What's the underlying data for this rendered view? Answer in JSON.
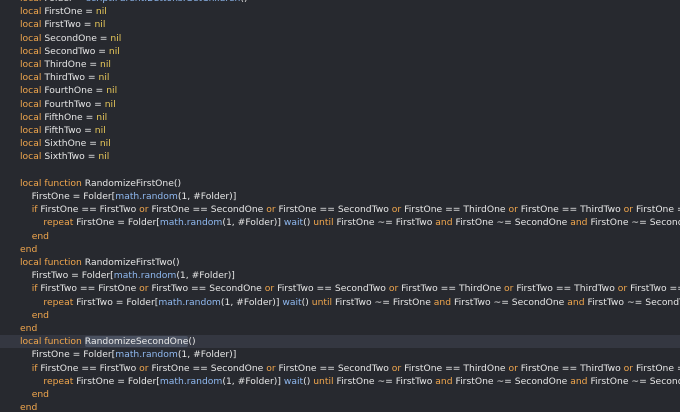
{
  "colors": {
    "background": "#27292f",
    "current_line": "#343741",
    "keyword": "#f0a64d",
    "nil": "#e8c85a",
    "identifier": "#e6e6e6",
    "builtin_call": "#8fb8ef"
  },
  "code_lines": [
    [
      [
        "kw",
        "local "
      ],
      [
        "txt",
        "Folder = "
      ],
      [
        "call",
        "script.Parent.Buttons:GetChildren"
      ],
      [
        "txt",
        "()"
      ]
    ],
    [
      [
        "kw",
        "local "
      ],
      [
        "txt",
        "FirstOne = "
      ],
      [
        "nil",
        "nil"
      ]
    ],
    [
      [
        "kw",
        "local "
      ],
      [
        "txt",
        "FirstTwo = "
      ],
      [
        "nil",
        "nil"
      ]
    ],
    [
      [
        "kw",
        "local "
      ],
      [
        "txt",
        "SecondOne = "
      ],
      [
        "nil",
        "nil"
      ]
    ],
    [
      [
        "kw",
        "local "
      ],
      [
        "txt",
        "SecondTwo = "
      ],
      [
        "nil",
        "nil"
      ]
    ],
    [
      [
        "kw",
        "local "
      ],
      [
        "txt",
        "ThirdOne = "
      ],
      [
        "nil",
        "nil"
      ]
    ],
    [
      [
        "kw",
        "local "
      ],
      [
        "txt",
        "ThirdTwo = "
      ],
      [
        "nil",
        "nil"
      ]
    ],
    [
      [
        "kw",
        "local "
      ],
      [
        "txt",
        "FourthOne = "
      ],
      [
        "nil",
        "nil"
      ]
    ],
    [
      [
        "kw",
        "local "
      ],
      [
        "txt",
        "FourthTwo = "
      ],
      [
        "nil",
        "nil"
      ]
    ],
    [
      [
        "kw",
        "local "
      ],
      [
        "txt",
        "FifthOne = "
      ],
      [
        "nil",
        "nil"
      ]
    ],
    [
      [
        "kw",
        "local "
      ],
      [
        "txt",
        "FifthTwo = "
      ],
      [
        "nil",
        "nil"
      ]
    ],
    [
      [
        "kw",
        "local "
      ],
      [
        "txt",
        "SixthOne = "
      ],
      [
        "nil",
        "nil"
      ]
    ],
    [
      [
        "kw",
        "local "
      ],
      [
        "txt",
        "SixthTwo = "
      ],
      [
        "nil",
        "nil"
      ]
    ],
    [],
    [
      [
        "kw",
        "local function "
      ],
      [
        "fn",
        "RandomizeFirstOne"
      ],
      [
        "txt",
        "()"
      ]
    ],
    [
      [
        "txt",
        "    FirstOne = Folder["
      ],
      [
        "call",
        "math.random"
      ],
      [
        "txt",
        "(1, #Folder)]"
      ]
    ],
    [
      [
        "txt",
        "    "
      ],
      [
        "kw",
        "if "
      ],
      [
        "txt",
        "FirstOne == FirstTwo "
      ],
      [
        "kw",
        "or "
      ],
      [
        "txt",
        "FirstOne == SecondOne "
      ],
      [
        "kw",
        "or "
      ],
      [
        "txt",
        "FirstOne == SecondTwo "
      ],
      [
        "kw",
        "or "
      ],
      [
        "txt",
        "FirstOne == ThirdOne "
      ],
      [
        "kw",
        "or "
      ],
      [
        "txt",
        "FirstOne == ThirdTwo "
      ],
      [
        "kw",
        "or "
      ],
      [
        "txt",
        "FirstOne == FourthOne"
      ]
    ],
    [
      [
        "txt",
        "        "
      ],
      [
        "kw",
        "repeat "
      ],
      [
        "txt",
        "FirstOne = Folder["
      ],
      [
        "call",
        "math.random"
      ],
      [
        "txt",
        "(1, #Folder)] "
      ],
      [
        "call",
        "wait"
      ],
      [
        "txt",
        "() "
      ],
      [
        "kw",
        "until "
      ],
      [
        "txt",
        "FirstOne ~= FirstTwo "
      ],
      [
        "kw",
        "and "
      ],
      [
        "txt",
        "FirstOne ~= SecondOne "
      ],
      [
        "kw",
        "and "
      ],
      [
        "txt",
        "FirstOne ~= SecondTwo "
      ],
      [
        "kw",
        "and "
      ],
      [
        "txt",
        "FirstOne ~="
      ]
    ],
    [
      [
        "txt",
        "    "
      ],
      [
        "kw",
        "end"
      ]
    ],
    [
      [
        "kw",
        "end"
      ]
    ],
    [
      [
        "kw",
        "local function "
      ],
      [
        "fn",
        "RandomizeFirstTwo"
      ],
      [
        "txt",
        "()"
      ]
    ],
    [
      [
        "txt",
        "    FirstTwo = Folder["
      ],
      [
        "call",
        "math.random"
      ],
      [
        "txt",
        "(1, #Folder)]"
      ]
    ],
    [
      [
        "txt",
        "    "
      ],
      [
        "kw",
        "if "
      ],
      [
        "txt",
        "FirstTwo == FirstOne "
      ],
      [
        "kw",
        "or "
      ],
      [
        "txt",
        "FirstTwo == SecondOne "
      ],
      [
        "kw",
        "or "
      ],
      [
        "txt",
        "FirstTwo == SecondTwo "
      ],
      [
        "kw",
        "or "
      ],
      [
        "txt",
        "FirstTwo == ThirdOne "
      ],
      [
        "kw",
        "or "
      ],
      [
        "txt",
        "FirstTwo == ThirdTwo "
      ],
      [
        "kw",
        "or "
      ],
      [
        "txt",
        "FirstTwo == FourthOne"
      ]
    ],
    [
      [
        "txt",
        "        "
      ],
      [
        "kw",
        "repeat "
      ],
      [
        "txt",
        "FirstTwo = Folder["
      ],
      [
        "call",
        "math.random"
      ],
      [
        "txt",
        "(1, #Folder)] "
      ],
      [
        "call",
        "wait"
      ],
      [
        "txt",
        "() "
      ],
      [
        "kw",
        "until "
      ],
      [
        "txt",
        "FirstTwo ~= FirstOne "
      ],
      [
        "kw",
        "and "
      ],
      [
        "txt",
        "FirstTwo ~= SecondOne "
      ],
      [
        "kw",
        "and "
      ],
      [
        "txt",
        "FirstTwo ~= SecondTwo "
      ],
      [
        "kw",
        "and "
      ],
      [
        "txt",
        "FirstTwo ~="
      ]
    ],
    [
      [
        "txt",
        "    "
      ],
      [
        "kw",
        "end"
      ]
    ],
    [
      [
        "kw",
        "end"
      ]
    ],
    [
      [
        "kw",
        "local function "
      ],
      [
        "hl",
        "RandomizeSecondOne"
      ],
      [
        "txt",
        "()"
      ]
    ],
    [
      [
        "txt",
        "    FirstOne = Folder["
      ],
      [
        "call",
        "math.random"
      ],
      [
        "txt",
        "(1, #Folder)]"
      ]
    ],
    [
      [
        "txt",
        "    "
      ],
      [
        "kw",
        "if "
      ],
      [
        "txt",
        "FirstOne == FirstTwo "
      ],
      [
        "kw",
        "or "
      ],
      [
        "txt",
        "FirstOne == SecondOne "
      ],
      [
        "kw",
        "or "
      ],
      [
        "txt",
        "FirstOne == SecondTwo "
      ],
      [
        "kw",
        "or "
      ],
      [
        "txt",
        "FirstOne == ThirdOne "
      ],
      [
        "kw",
        "or "
      ],
      [
        "txt",
        "FirstOne == ThirdTwo "
      ],
      [
        "kw",
        "or "
      ],
      [
        "txt",
        "FirstOne == FourthOne"
      ]
    ],
    [
      [
        "txt",
        "        "
      ],
      [
        "kw",
        "repeat "
      ],
      [
        "txt",
        "FirstOne = Folder["
      ],
      [
        "call",
        "math.random"
      ],
      [
        "txt",
        "(1, #Folder)] "
      ],
      [
        "call",
        "wait"
      ],
      [
        "txt",
        "() "
      ],
      [
        "kw",
        "until "
      ],
      [
        "txt",
        "FirstOne ~= FirstTwo "
      ],
      [
        "kw",
        "and "
      ],
      [
        "txt",
        "FirstOne ~= SecondOne "
      ],
      [
        "kw",
        "and "
      ],
      [
        "txt",
        "FirstOne ~= SecondTwo "
      ],
      [
        "kw",
        "and "
      ],
      [
        "txt",
        "FirstOne ~="
      ]
    ],
    [
      [
        "txt",
        "    "
      ],
      [
        "kw",
        "end"
      ]
    ],
    [
      [
        "kw",
        "end"
      ]
    ]
  ]
}
